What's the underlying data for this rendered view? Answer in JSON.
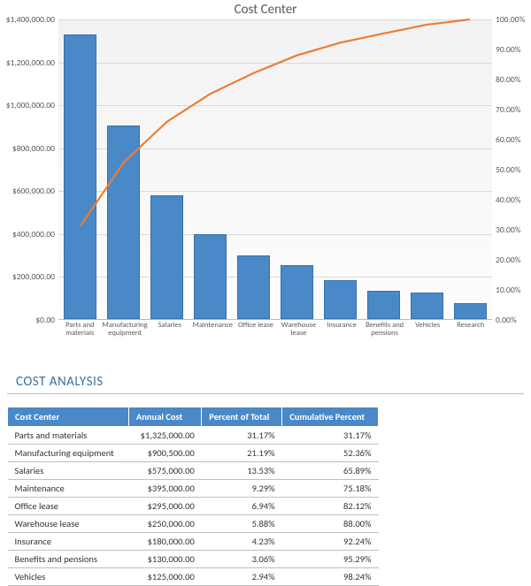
{
  "chart_data": {
    "type": "pareto",
    "title": "Cost Center",
    "categories": [
      "Parts and materials",
      "Manufacturing equipment",
      "Salaries",
      "Maintenance",
      "Office lease",
      "Warehouse lease",
      "Insurance",
      "Benefits and pensions",
      "Vehicles",
      "Research"
    ],
    "bars": {
      "name": "Annual Cost",
      "values": [
        1325000,
        900500,
        575000,
        395000,
        295000,
        250000,
        180000,
        130000,
        125000,
        75000
      ]
    },
    "line": {
      "name": "Cumulative Percent",
      "values": [
        31.17,
        52.36,
        65.89,
        75.18,
        82.12,
        88.0,
        92.24,
        95.29,
        98.24,
        100.0
      ]
    },
    "y_left": {
      "min": 0,
      "max": 1400000,
      "ticks": [
        0,
        200000,
        400000,
        600000,
        800000,
        1000000,
        1200000,
        1400000
      ],
      "tick_labels": [
        "$0.00",
        "$200,000.00",
        "$400,000.00",
        "$600,000.00",
        "$800,000.00",
        "$1,000,000.00",
        "$1,200,000.00",
        "$1,400,000.00"
      ]
    },
    "y_right": {
      "min": 0,
      "max": 100,
      "ticks": [
        0,
        10,
        20,
        30,
        40,
        50,
        60,
        70,
        80,
        90,
        100
      ],
      "tick_labels": [
        "0.00%",
        "10.00%",
        "20.00%",
        "30.00%",
        "40.00%",
        "50.00%",
        "60.00%",
        "70.00%",
        "80.00%",
        "90.00%",
        "100.00%"
      ]
    }
  },
  "section": {
    "title": "COST ANALYSIS"
  },
  "table": {
    "headers": [
      "Cost Center",
      "Annual Cost",
      "Percent of Total",
      "Cumulative Percent"
    ],
    "rows": [
      [
        "Parts and materials",
        "$1,325,000.00",
        "31.17%",
        "31.17%"
      ],
      [
        "Manufacturing equipment",
        "$900,500.00",
        "21.19%",
        "52.36%"
      ],
      [
        "Salaries",
        "$575,000.00",
        "13.53%",
        "65.89%"
      ],
      [
        "Maintenance",
        "$395,000.00",
        "9.29%",
        "75.18%"
      ],
      [
        "Office lease",
        "$295,000.00",
        "6.94%",
        "82.12%"
      ],
      [
        "Warehouse lease",
        "$250,000.00",
        "5.88%",
        "88.00%"
      ],
      [
        "Insurance",
        "$180,000.00",
        "4.23%",
        "92.24%"
      ],
      [
        "Benefits and pensions",
        "$130,000.00",
        "3.06%",
        "95.29%"
      ],
      [
        "Vehicles",
        "$125,000.00",
        "2.94%",
        "98.24%"
      ]
    ]
  }
}
